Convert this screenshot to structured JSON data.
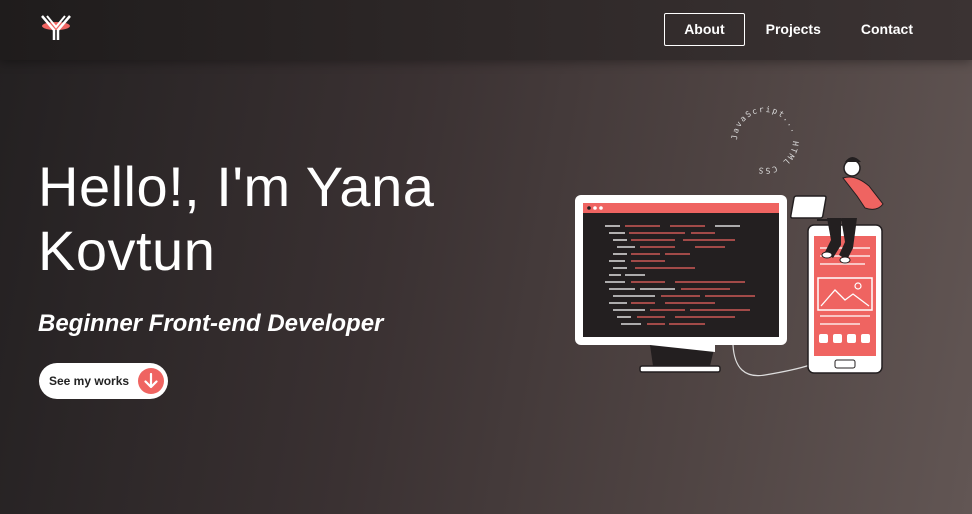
{
  "header": {
    "logo_icon": "y-logo-icon",
    "nav": [
      {
        "label": "About",
        "active": true
      },
      {
        "label": "Projects",
        "active": false
      },
      {
        "label": "Contact",
        "active": false
      }
    ]
  },
  "hero": {
    "title": "Hello!, I'm Yana Kovtun",
    "subtitle": "Beginner Front-end Developer",
    "cta_label": "See my works",
    "cta_icon": "arrow-down-icon"
  },
  "illustration": {
    "circle_text": "JavaScript... HTML CSS"
  },
  "colors": {
    "accent": "#ef6461",
    "background_dark": "#232021",
    "background_light": "#625654"
  }
}
